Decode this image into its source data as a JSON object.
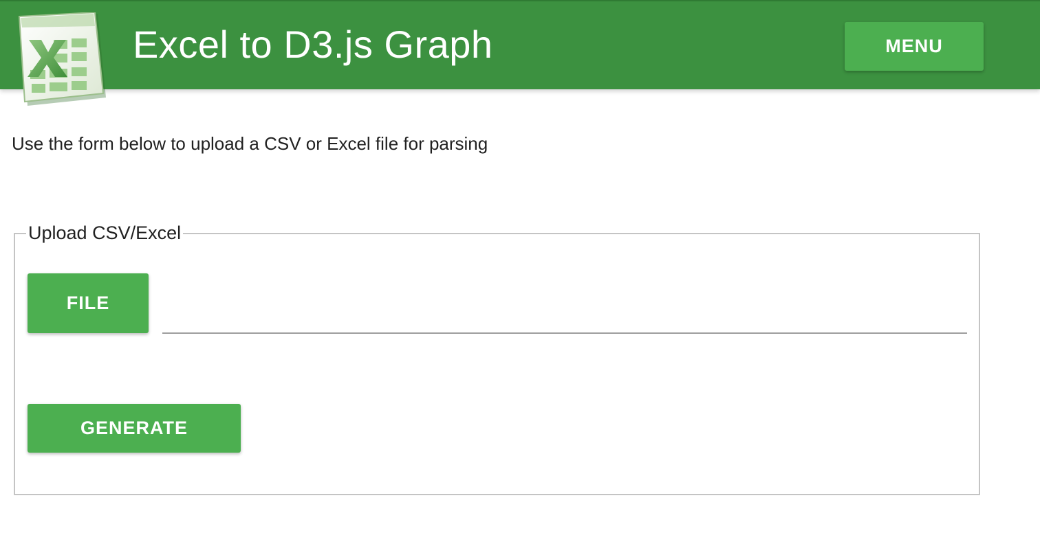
{
  "header": {
    "title": "Excel to D3.js Graph",
    "menu_label": "MENU",
    "logo_icon": "excel-logo-icon",
    "color": "#3c9140"
  },
  "main": {
    "intro_text": "Use the form below to upload a CSV or Excel file for parsing",
    "form": {
      "legend": "Upload CSV/Excel",
      "file_button_label": "FILE",
      "file_path_value": "",
      "generate_button_label": "GENERATE"
    }
  },
  "colors": {
    "accent": "#4caf50",
    "header": "#3c9140",
    "border": "#c4c4c4"
  }
}
